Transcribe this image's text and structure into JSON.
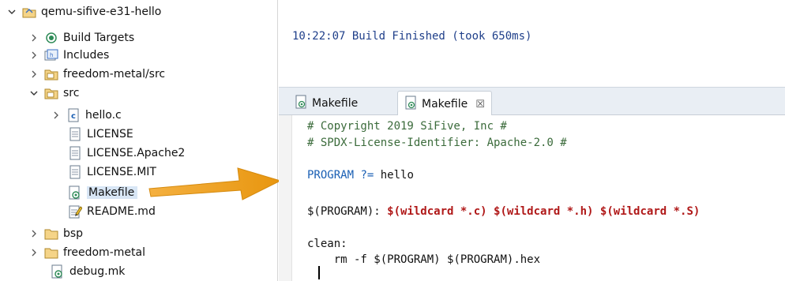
{
  "tree": {
    "items": [
      {
        "label": "qemu-sifive-e31-hello",
        "toggle": "expanded",
        "icon": "project-folder-icon"
      },
      {
        "label": "Build Targets",
        "toggle": "collapsed",
        "icon": "build-targets-icon"
      },
      {
        "label": "Includes",
        "toggle": "collapsed",
        "icon": "includes-icon"
      },
      {
        "label": "freedom-metal/src",
        "toggle": "collapsed",
        "icon": "source-folder-icon"
      },
      {
        "label": "src",
        "toggle": "expanded",
        "icon": "source-folder-icon"
      },
      {
        "label": "hello.c",
        "toggle": "collapsed",
        "icon": "c-file-icon"
      },
      {
        "label": "LICENSE",
        "toggle": "none",
        "icon": "text-file-icon"
      },
      {
        "label": "LICENSE.Apache2",
        "toggle": "none",
        "icon": "text-file-icon"
      },
      {
        "label": "LICENSE.MIT",
        "toggle": "none",
        "icon": "text-file-icon"
      },
      {
        "label": "Makefile",
        "toggle": "none",
        "icon": "makefile-icon",
        "selected": true
      },
      {
        "label": "README.md",
        "toggle": "none",
        "icon": "markdown-file-icon"
      },
      {
        "label": "bsp",
        "toggle": "collapsed",
        "icon": "folder-icon"
      },
      {
        "label": "freedom-metal",
        "toggle": "collapsed",
        "icon": "folder-icon"
      },
      {
        "label": "debug.mk",
        "toggle": "none",
        "icon": "makefile-icon"
      }
    ]
  },
  "console": {
    "line": "10:22:07 Build Finished (took 650ms)"
  },
  "editor": {
    "tabs": [
      {
        "label": "Makefile",
        "active": false
      },
      {
        "label": "Makefile",
        "active": true,
        "close": "☒"
      }
    ],
    "lines": [
      {
        "text": "# Copyright 2019 SiFive, Inc #"
      },
      {
        "text": "# SPDX-License-Identifier: Apache-2.0 #"
      },
      {
        "text": ""
      },
      {
        "var": "PROGRAM",
        "op": " ?=",
        "rest": " hello"
      },
      {
        "text": ""
      },
      {
        "prog": "$(PROGRAM)",
        "colon": ": ",
        "w1": "$(wildcard",
        "a1": " *.c) ",
        "w2": "$(wildcard",
        "a2": " *.h) ",
        "w3": "$(wildcard",
        "a3": " *.S)"
      },
      {
        "text": ""
      },
      {
        "text": "clean:"
      },
      {
        "cmd": "    rm -f ",
        "p1": "$(PROGRAM)",
        "sp": " ",
        "p2": "$(PROGRAM)",
        "tail": ".hex"
      }
    ]
  },
  "colors": {
    "accent_arrow": "#f0a020",
    "selection": "#d8e6f5",
    "console_text": "#1f3f8a",
    "keyword_blue": "#1a5fb4",
    "keyword_red": "#b01818"
  }
}
